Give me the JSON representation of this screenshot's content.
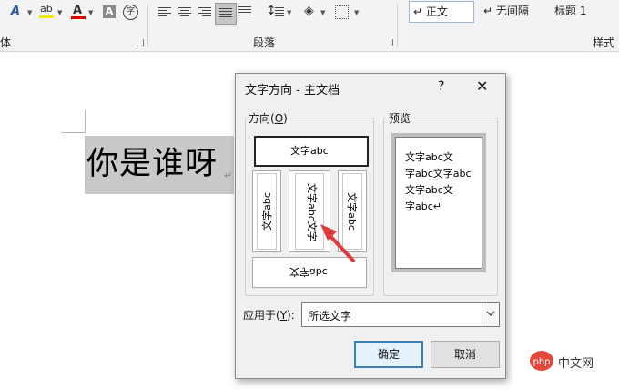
{
  "ribbon": {
    "font_group_label": "体",
    "paragraph_group_label": "段落",
    "styles_group_label": "样式",
    "style_items": [
      {
        "label": "↵ 正文",
        "selected": true
      },
      {
        "label": "↵ 无间隔",
        "selected": false
      },
      {
        "label": "标题 1",
        "selected": false
      }
    ],
    "font_color": "#e00000",
    "highlight_color": "#f5e800",
    "accent_color": "#2b579a",
    "glyphs": {
      "text_effects": "A",
      "highlight": "ab",
      "font_color": "A",
      "char_shading": "A",
      "enclose": "字"
    }
  },
  "document": {
    "text": "你是谁呀",
    "paragraph_mark": "↵"
  },
  "dialog": {
    "title": "文字方向 - 主文档",
    "help": "?",
    "close": "✕",
    "orientation_legend": "方向(O)",
    "orientation_legend_plain": "方向(",
    "orientation_legend_key": "O",
    "orientation_legend_end": ")",
    "preview_legend": "预览",
    "options": {
      "horizontal": "文字abc",
      "vertical_left": "文字abc",
      "vertical_stacked": "文字abc文字",
      "vertical_right": "文字abc",
      "horizontal_flipped": "文字abc"
    },
    "preview_lines": [
      "文字abc文",
      "字abc文字abc",
      "文字abc文",
      "字abc↵"
    ],
    "apply_label_plain": "应用于(",
    "apply_label_key": "Y",
    "apply_label_end": "):",
    "apply_value": "所选文字",
    "ok_label": "确定",
    "cancel_label": "取消"
  },
  "watermark": {
    "text": "中文网",
    "logo_text": "php"
  }
}
